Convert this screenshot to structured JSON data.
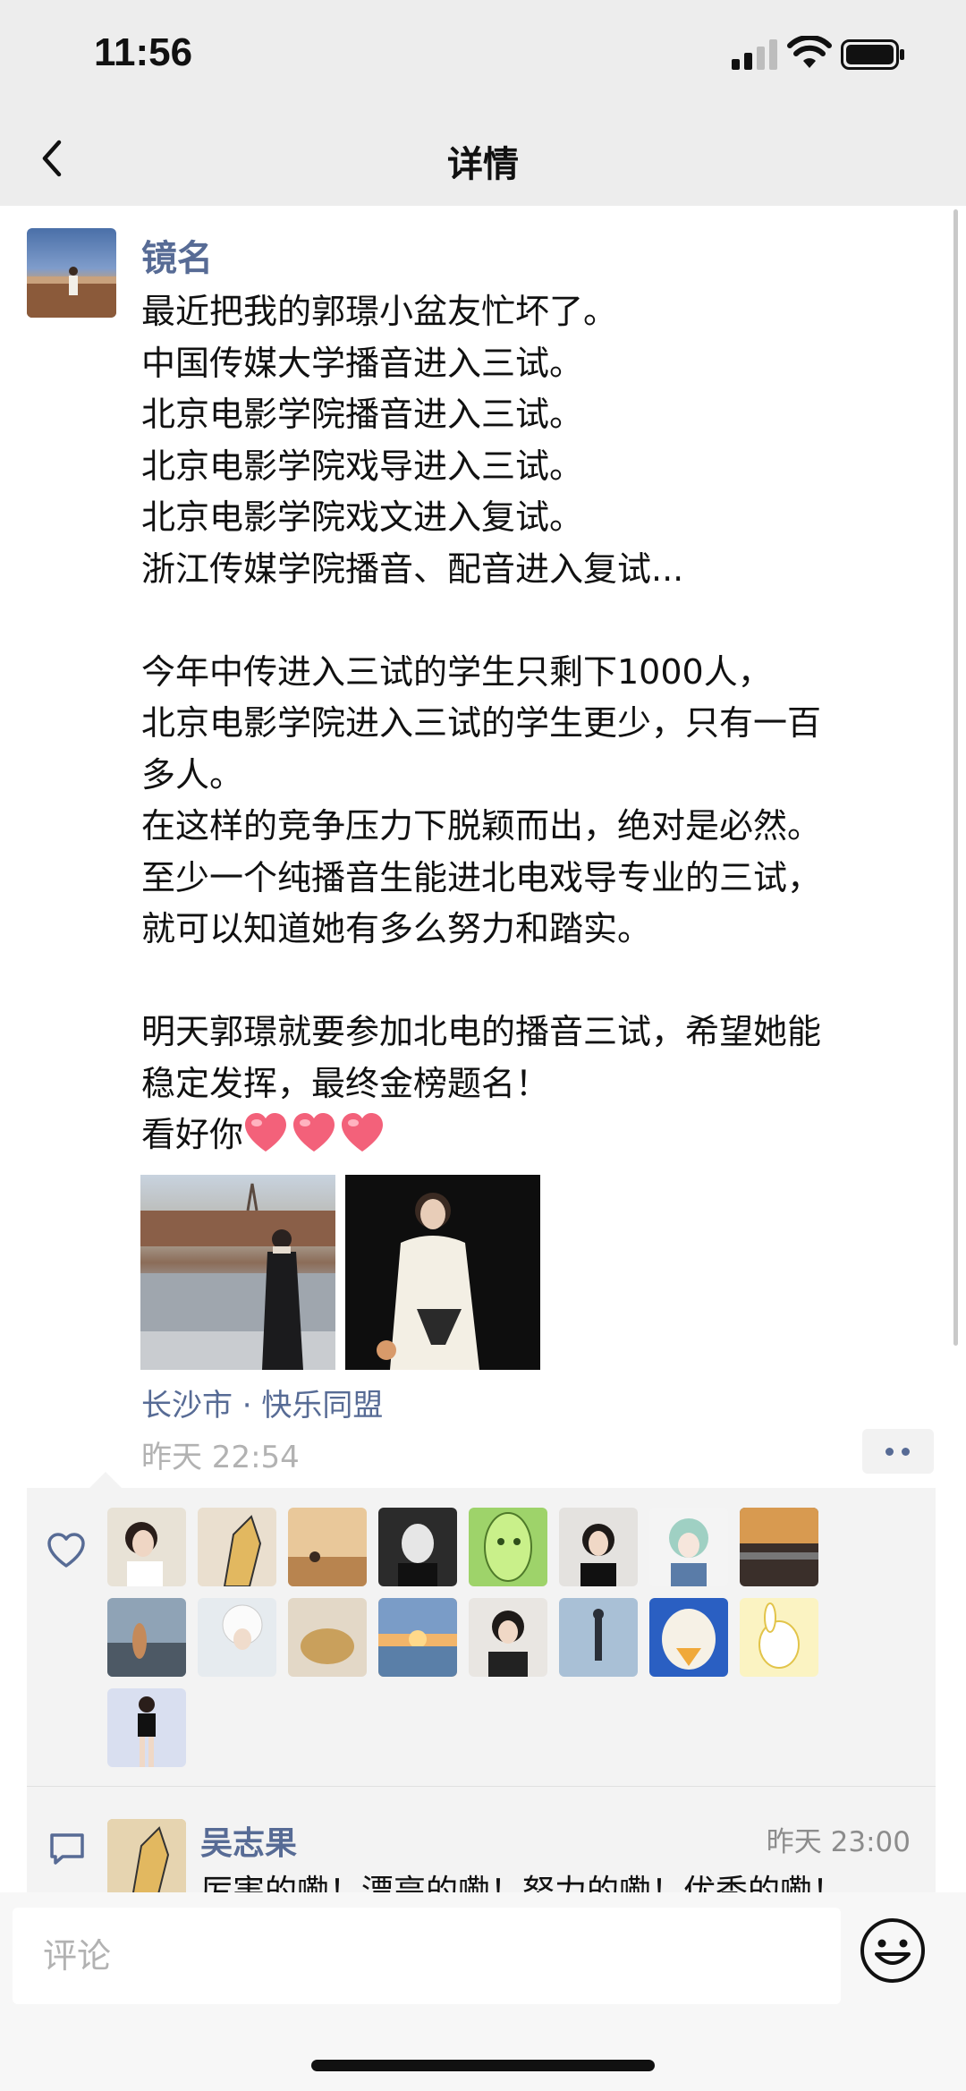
{
  "status_bar": {
    "time": "11:56"
  },
  "nav": {
    "title": "详情"
  },
  "post": {
    "author": "镜名",
    "text": "最近把我的郭璟小盆友忙坏了。\n中国传媒大学播音进入三试。\n北京电影学院播音进入三试。\n北京电影学院戏导进入三试。\n北京电影学院戏文进入复试。\n浙江传媒学院播音、配音进入复试...\n\n今年中传进入三试的学生只剩下1000人，\n北京电影学院进入三试的学生更少，只有一百\n多人。\n在这样的竞争压力下脱颖而出，绝对是必然。\n至少一个纯播音生能进北电戏导专业的三试，\n就可以知道她有多么努力和踏实。\n\n明天郭璟就要参加北电的播音三试，希望她能\n稳定发挥，最终金榜题名！",
    "last_line": "看好你",
    "hearts": [
      "heart-icon",
      "heart-icon",
      "heart-icon"
    ],
    "location": "长沙市 · 快乐同盟",
    "time": "昨天 22:54"
  },
  "likes": {
    "avatars": [
      "avatar-woman-portrait",
      "avatar-cartoon-duck",
      "avatar-sunset-figure",
      "avatar-man-dark",
      "avatar-green-face",
      "avatar-woman-black",
      "avatar-anime-green-hair",
      "avatar-train-station",
      "avatar-balcony-figure",
      "avatar-woman-hat",
      "avatar-food-bowl",
      "avatar-beach-sunset",
      "avatar-woman-coat",
      "avatar-silhouette-blue",
      "avatar-duck-blue",
      "avatar-cartoon-rabbit",
      "avatar-dancer"
    ]
  },
  "comment": {
    "name": "吴志果",
    "time": "昨天 23:00",
    "text": "厉害的嘞！漂亮的嘞！努力的嘞！优秀的嘞！"
  },
  "input": {
    "placeholder": "评论"
  },
  "colors": {
    "link": "#576b95",
    "bg_header": "#ededed",
    "heart": "#f3617a"
  }
}
